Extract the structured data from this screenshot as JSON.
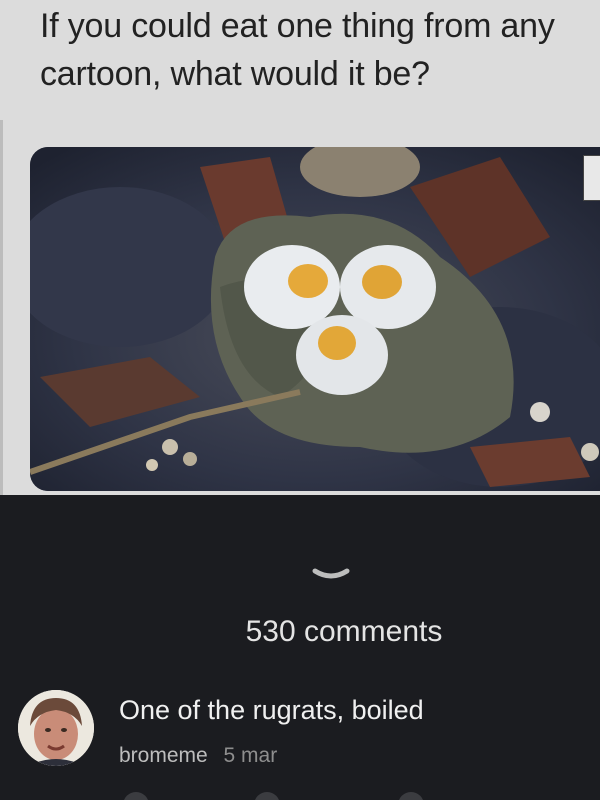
{
  "post": {
    "title": "If you could eat one thing from any cartoon, what would it be?"
  },
  "image": {
    "icon": "cartoon-food-photo"
  },
  "comments_section": {
    "count_label": "530 comments",
    "toggle_icon": "chevron-down-icon"
  },
  "comments": [
    {
      "text": "One of the rugrats, boiled",
      "author": "bromeme",
      "date": "5 mar"
    }
  ],
  "colors": {
    "background_dark": "#1b1c20",
    "card_light": "#dcdcdc",
    "text_light": "#f0f0f0",
    "text_muted": "#8e8e8e"
  }
}
